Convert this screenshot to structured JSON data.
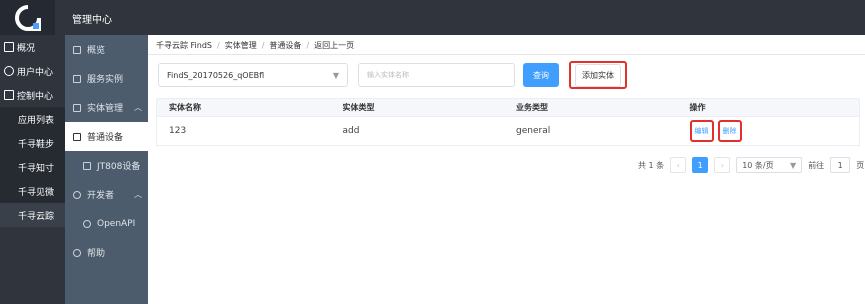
{
  "header": {
    "title": "管理中心"
  },
  "leftnav": {
    "items": [
      {
        "label": "概况",
        "icon": "grid-icon"
      },
      {
        "label": "用户中心",
        "icon": "user-icon"
      },
      {
        "label": "控制中心",
        "icon": "monitor-icon"
      }
    ],
    "subitems": [
      "应用列表",
      "千寻鞋步",
      "千寻知寸",
      "千寻见微",
      "千寻云踪"
    ]
  },
  "subnav": {
    "items": [
      {
        "label": "概览",
        "icon": "list-icon"
      },
      {
        "label": "服务实例",
        "icon": "printer-icon"
      },
      {
        "label": "实体管理",
        "icon": "box-icon",
        "caret": "︿"
      },
      {
        "label": "普通设备",
        "icon": "doc-icon"
      },
      {
        "label": "JT808设备",
        "icon": "doc-icon"
      },
      {
        "label": "开发者",
        "icon": "person-icon",
        "caret": "︿"
      },
      {
        "label": "OpenAPI",
        "icon": "link-icon"
      },
      {
        "label": "帮助",
        "icon": "help-icon"
      }
    ]
  },
  "breadcrumb": [
    "千寻云踪 FindS",
    "实体管理",
    "普通设备",
    "返回上一页"
  ],
  "filter": {
    "select_value": "FindS_20170526_qOEBfl",
    "search_placeholder": "输入实体名称",
    "query_label": "查询",
    "add_label": "添加实体"
  },
  "table": {
    "headers": [
      "实体名称",
      "实体类型",
      "业务类型",
      "操作"
    ],
    "rows": [
      {
        "name": "123",
        "type": "add",
        "biz": "general",
        "edit": "编辑",
        "delete": "删除"
      }
    ]
  },
  "pagination": {
    "total": "共 1 条",
    "prev": "‹",
    "page": "1",
    "next": "›",
    "size": "10 条/页",
    "goto_label": "前往",
    "goto_value": "1",
    "page_suffix": "页"
  },
  "colors": {
    "accent": "#409eff",
    "highlight": "#e0312c",
    "sidebar": "#2f343d",
    "subnav": "#4d5c6c"
  }
}
